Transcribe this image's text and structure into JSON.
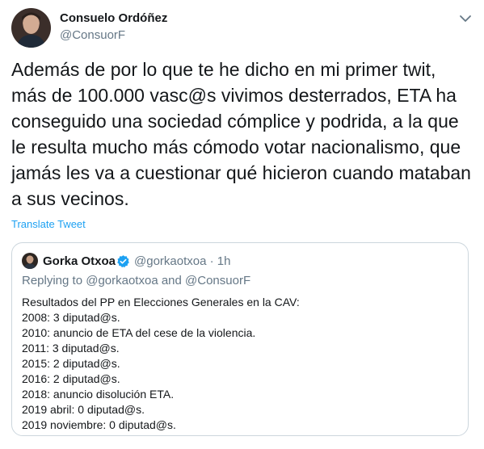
{
  "author": {
    "name": "Consuelo Ordóñez",
    "handle": "@ConsuorF",
    "avatar_icon": "profile-photo"
  },
  "tweet": {
    "lines": [
      "Además de por lo que te he dicho en mi primer twit,",
      "más de 100.000 vasc@s vivimos desterrados, ETA ha",
      "conseguido una sociedad cómplice y podrida, a la que",
      "le resulta mucho más cómodo votar nacionalismo, que",
      "jamás les va a cuestionar qué hicieron cuando mataban",
      "a sus vecinos."
    ],
    "translate_label": "Translate Tweet",
    "menu_icon": "chevron-down-icon"
  },
  "quoted": {
    "name": "Gorka Otxoa",
    "verified_icon": "verified-badge-icon",
    "meta": "@gorkaotxoa · 1h",
    "replying": "Replying to @gorkaotxoa and @ConsuorF",
    "lines": [
      "Resultados del PP en Elecciones Generales en la CAV:",
      "2008: 3 diputad@s.",
      "2010: anuncio de ETA del cese de la violencia.",
      "2011: 3 diputad@s.",
      "2015: 2 diputad@s.",
      "2016: 2 diputad@s.",
      "2018: anuncio disolución ETA.",
      "2019 abril: 0 diputad@s.",
      "2019 noviembre: 0 diputad@s."
    ]
  },
  "colors": {
    "text": "#14171a",
    "secondary": "#657786",
    "link": "#1da1f2",
    "border": "#ccd6dd"
  }
}
